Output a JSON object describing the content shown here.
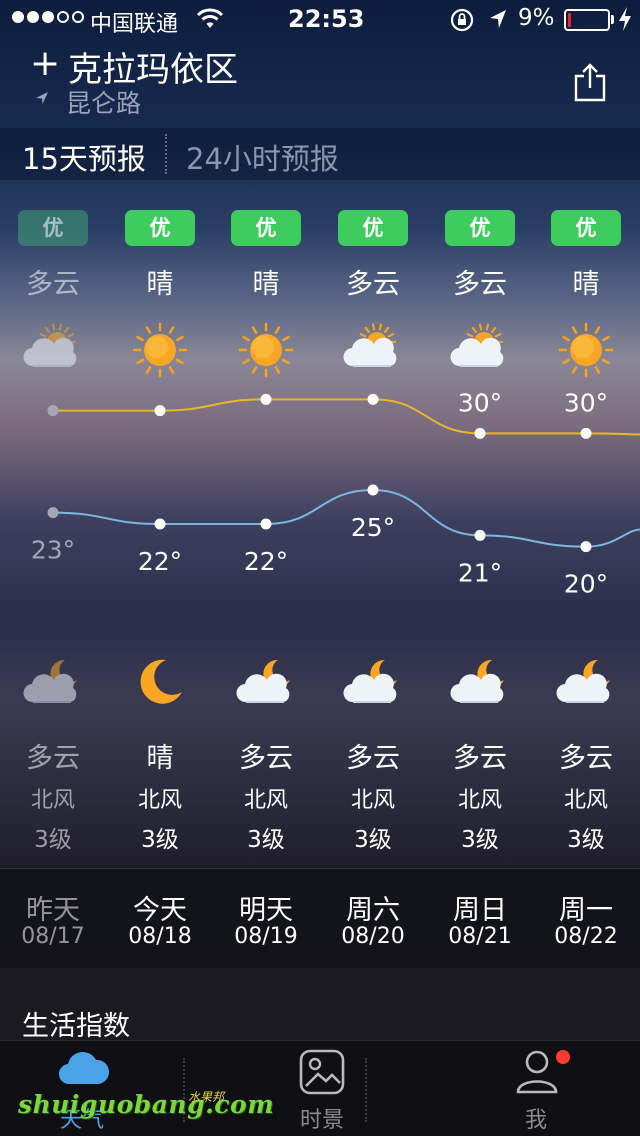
{
  "status_bar": {
    "carrier": "中国联通",
    "time": "22:53",
    "battery": "9%",
    "battery_fill": 0.09,
    "signal_bars_on": 3,
    "signal_bars_total": 5
  },
  "header": {
    "add_symbol": "+",
    "city": "克拉玛依区",
    "street": "昆仑路"
  },
  "tabs": {
    "forecast_15": "15天预报",
    "forecast_24": "24小时预报"
  },
  "days": [
    {
      "aqi": "优",
      "day_cond": "多云",
      "day_icon": "partly-cloudy-icon",
      "high": "32°",
      "low": "23°",
      "night_icon": "cloudy-moon-icon",
      "night_cond": "多云",
      "wind": "北风",
      "level": "3级",
      "name": "昨天",
      "date": "08/17",
      "past": true
    },
    {
      "aqi": "优",
      "day_cond": "晴",
      "day_icon": "sun-icon",
      "high": "32°",
      "low": "22°",
      "night_icon": "moon-icon",
      "night_cond": "晴",
      "wind": "北风",
      "level": "3级",
      "name": "今天",
      "date": "08/18",
      "past": false
    },
    {
      "aqi": "优",
      "day_cond": "晴",
      "day_icon": "sun-icon",
      "high": "33°",
      "low": "22°",
      "night_icon": "cloudy-moon-icon",
      "night_cond": "多云",
      "wind": "北风",
      "level": "3级",
      "name": "明天",
      "date": "08/19",
      "past": false
    },
    {
      "aqi": "优",
      "day_cond": "多云",
      "day_icon": "partly-cloudy-icon",
      "high": "33°",
      "low": "25°",
      "night_icon": "cloudy-moon-icon",
      "night_cond": "多云",
      "wind": "北风",
      "level": "3级",
      "name": "周六",
      "date": "08/20",
      "past": false
    },
    {
      "aqi": "优",
      "day_cond": "多云",
      "day_icon": "partly-cloudy-icon",
      "high": "30°",
      "low": "21°",
      "night_icon": "cloudy-moon-icon",
      "night_cond": "多云",
      "wind": "北风",
      "level": "3级",
      "name": "周日",
      "date": "08/21",
      "past": false
    },
    {
      "aqi": "优",
      "day_cond": "晴",
      "day_icon": "sun-icon",
      "high": "30°",
      "low": "20°",
      "night_icon": "cloudy-moon-icon",
      "night_cond": "多云",
      "wind": "北风",
      "level": "3级",
      "name": "周一",
      "date": "08/22",
      "past": false
    }
  ],
  "chart_data": {
    "type": "line",
    "categories": [
      "08/17",
      "08/18",
      "08/19",
      "08/20",
      "08/21",
      "08/22"
    ],
    "series": [
      {
        "values": [
          32,
          32,
          33,
          33,
          30,
          30
        ],
        "color": "#e8b62a"
      },
      {
        "values": [
          23,
          22,
          22,
          25,
          21,
          20
        ],
        "color": "#7ab8e0"
      }
    ]
  },
  "life_index": {
    "title": "生活指数"
  },
  "tab_bar": {
    "weather": "天气",
    "scenery": "时景",
    "me": "我"
  },
  "watermark": {
    "main": "shuiguobang.com",
    "sub": "水果邦"
  },
  "colors": {
    "aqi_good": "#3ecc5e",
    "active_tab": "#4aa3e6",
    "badge": "#ff3b30"
  }
}
